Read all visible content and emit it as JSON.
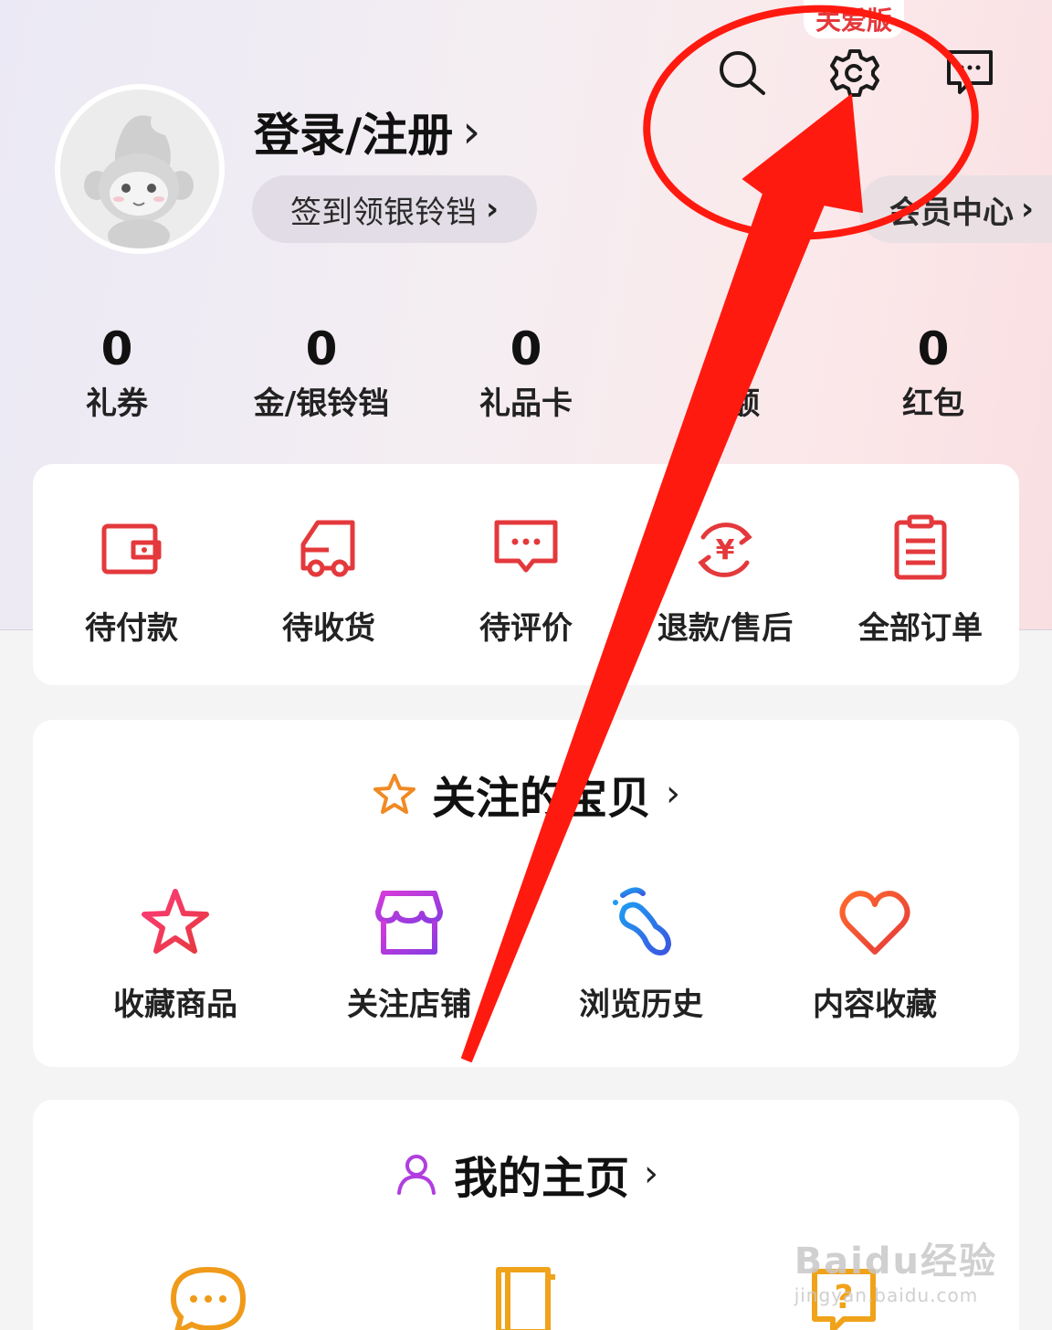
{
  "header": {
    "care_badge": "关爱版",
    "login_label": "登录/注册",
    "login_chevron": "›",
    "checkin_label": "签到领银铃铛",
    "checkin_chevron": "›",
    "member_label": "会员中心",
    "member_chevron": "›",
    "icons": [
      "search-icon",
      "settings-icon",
      "message-icon"
    ]
  },
  "stats": [
    {
      "value": "0",
      "label": "礼券"
    },
    {
      "value": "0",
      "label": "金/银铃铛"
    },
    {
      "value": "0",
      "label": "礼品卡"
    },
    {
      "value": "0",
      "label": "余额"
    },
    {
      "value": "0",
      "label": "红包"
    }
  ],
  "orders": [
    {
      "label": "待付款",
      "icon": "wallet-icon"
    },
    {
      "label": "待收货",
      "icon": "truck-icon"
    },
    {
      "label": "待评价",
      "icon": "comment-icon"
    },
    {
      "label": "退款/售后",
      "icon": "refund-icon"
    },
    {
      "label": "全部订单",
      "icon": "clipboard-icon"
    }
  ],
  "favorites": {
    "title": "关注的宝贝",
    "chevron": "›",
    "items": [
      {
        "label": "收藏商品",
        "icon": "star-outline-icon"
      },
      {
        "label": "关注店铺",
        "icon": "store-icon"
      },
      {
        "label": "浏览历史",
        "icon": "footprint-icon"
      },
      {
        "label": "内容收藏",
        "icon": "heart-icon"
      }
    ]
  },
  "homepage": {
    "title": "我的主页",
    "chevron": "›",
    "items": [
      {
        "icon": "chat-bubble-icon"
      },
      {
        "icon": "book-icon"
      },
      {
        "icon": "question-icon"
      }
    ]
  },
  "watermark": {
    "brand": "Baidu经验",
    "url": "jingyan.baidu.com"
  },
  "colors": {
    "accent_red": "#e4393c",
    "annotation_red": "#ff1a10",
    "gradient_purple": "#a64bd6"
  }
}
